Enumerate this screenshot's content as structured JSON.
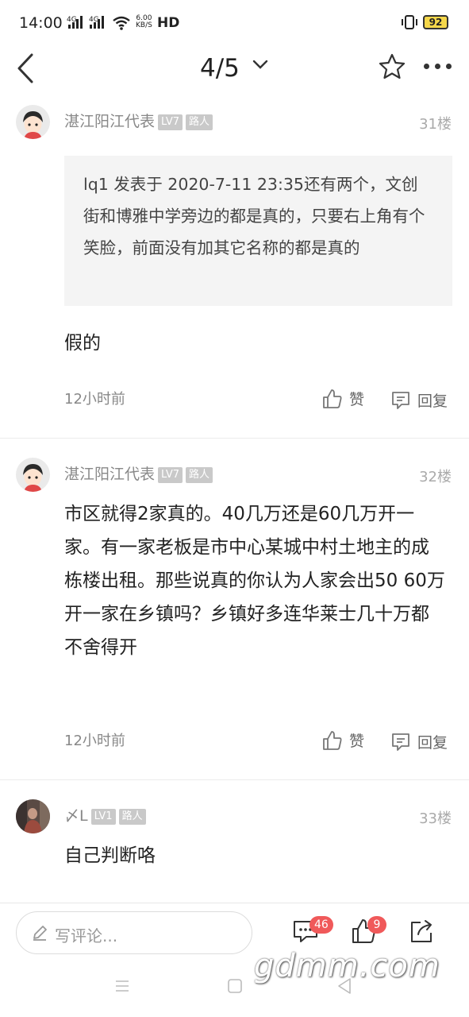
{
  "status_bar": {
    "time": "14:00",
    "signal1": "4G",
    "signal2": "4G",
    "speed_value": "6.00",
    "speed_unit": "KB/S",
    "hd": "HD",
    "battery": "92"
  },
  "header": {
    "page_indicator": "4/5"
  },
  "comments": [
    {
      "username": "湛江阳江代表",
      "level": "LV7",
      "tag": "路人",
      "floor": "31楼",
      "quote": "lq1 发表于 2020-7-11 23:35还有两个，文创街和博雅中学旁边的都是真的，只要右上角有个笑脸，前面没有加其它名称的都是真的",
      "content": "假的",
      "time": "12小时前",
      "like_label": "赞",
      "reply_label": "回复"
    },
    {
      "username": "湛江阳江代表",
      "level": "LV7",
      "tag": "路人",
      "floor": "32楼",
      "content": "市区就得2家真的。40几万还是60几万开一家。有一家老板是市中心某城中村土地主的成栋楼出租。那些说真的你认为人家会出50 60万开一家在乡镇吗？乡镇好多连华莱士几十万都不舍得开",
      "time": "12小时前",
      "like_label": "赞",
      "reply_label": "回复"
    },
    {
      "username": "〆L",
      "level": "LV1",
      "tag": "路人",
      "floor": "33楼",
      "content": "自己判断咯"
    }
  ],
  "bottom_bar": {
    "input_placeholder": "写评论...",
    "comment_count": "46",
    "like_count": "9"
  },
  "watermark": "gdmm.com",
  "colors": {
    "badge_red": "#f0595a",
    "level_badge": "#c9c9c9",
    "quote_bg": "#f4f4f4"
  }
}
